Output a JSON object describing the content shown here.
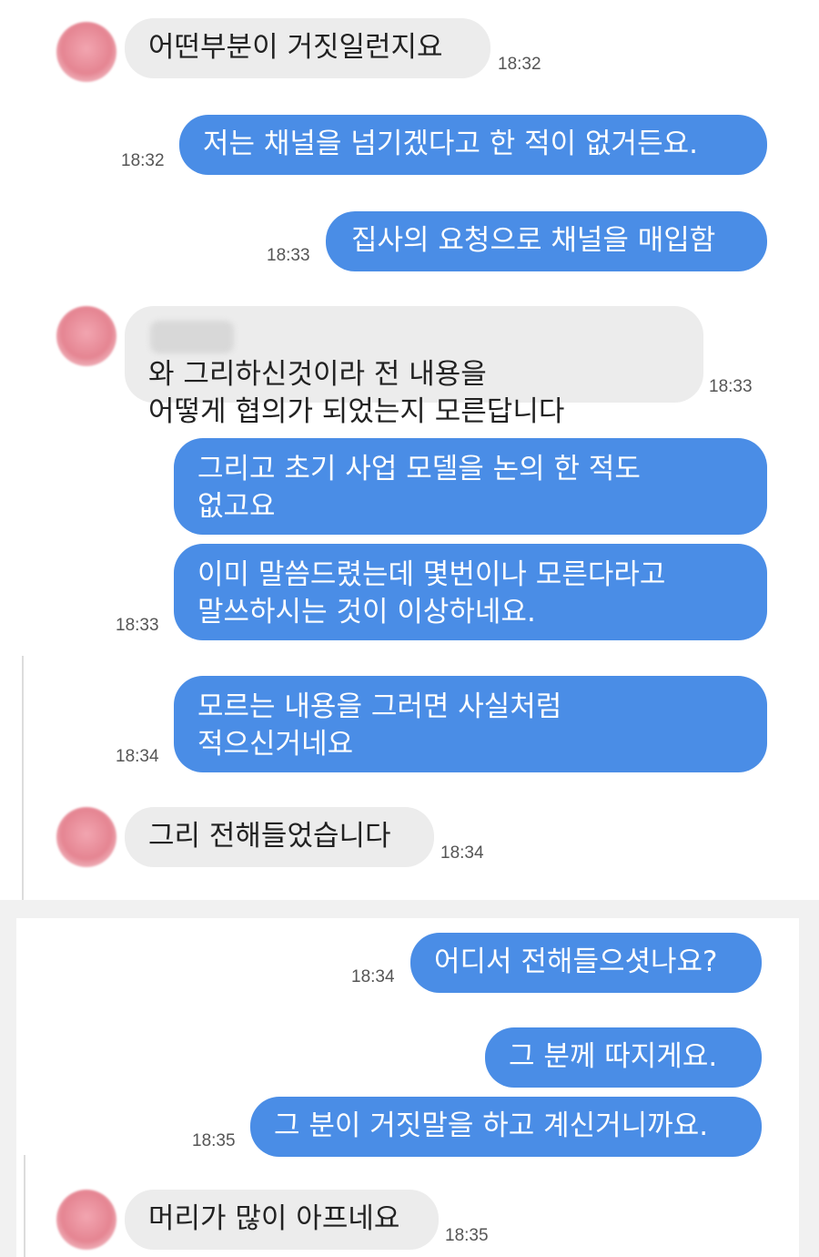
{
  "messages": [
    {
      "side": "in",
      "text": "어떤부분이 거짓일런지요",
      "time": "18:32"
    },
    {
      "side": "out",
      "text": "저는 채널을 넘기겠다고 한 적이 없거든요.",
      "time": "18:32"
    },
    {
      "side": "out",
      "text": "집사의 요청으로 채널을 매입함",
      "time": "18:33"
    },
    {
      "side": "in",
      "text": "  와 그리하신것이라 전 내용을\n어떻게 협의가 되었는지 모른답니다",
      "time": "18:33"
    },
    {
      "side": "out",
      "text": "그리고 초기 사업 모델을 논의 한 적도\n없고요",
      "time": ""
    },
    {
      "side": "out",
      "text": "이미 말씀드렸는데 몇번이나 모른다라고\n말쓰하시는 것이 이상하네요.",
      "time": "18:33"
    },
    {
      "side": "out",
      "text": "모르는 내용을 그러면 사실처럼\n적으신거네요",
      "time": "18:34"
    },
    {
      "side": "in",
      "text": "그리 전해들었습니다",
      "time": "18:34"
    },
    {
      "side": "out",
      "text": "어디서 전해들으셧나요?",
      "time": "18:34"
    },
    {
      "side": "out",
      "text": "그 분께 따지게요.",
      "time": ""
    },
    {
      "side": "out",
      "text": "그 분이 거짓말을 하고 계신거니까요.",
      "time": "18:35"
    },
    {
      "side": "in",
      "text": "머리가 많이 아프네요",
      "time": "18:35"
    }
  ],
  "colors": {
    "outgoing_bubble": "#4a8de6",
    "incoming_bubble": "#ececec",
    "avatar": "#e58592"
  }
}
